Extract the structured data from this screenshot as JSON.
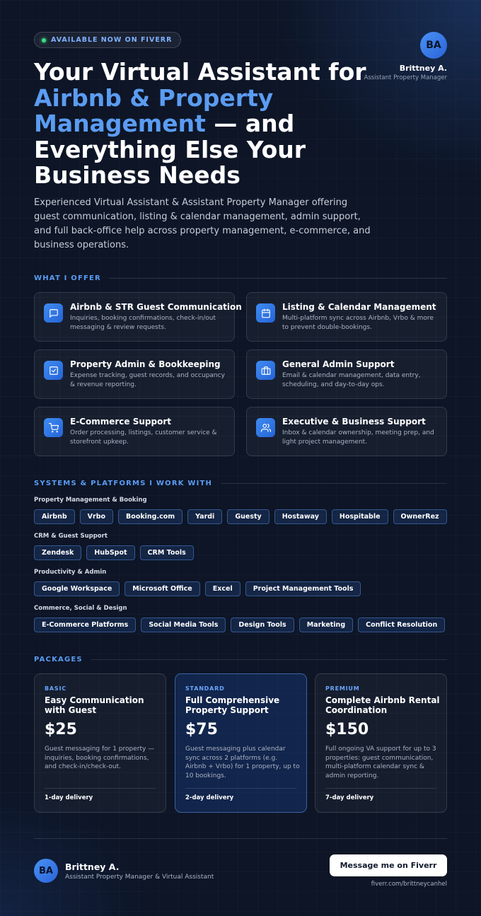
{
  "header": {
    "badge": "AVAILABLE NOW ON FIVERR",
    "avatar_initials": "BA",
    "name": "Brittney A.",
    "role": "Assistant Property Manager"
  },
  "hero": {
    "line1": "Your Virtual Assistant for",
    "accent": "Airbnb & Property Management",
    "line2": " — and Everything Else Your Business Needs",
    "intro": "Experienced Virtual Assistant & Assistant Property Manager offering guest communication, listing & calendar management, admin support, and full back-office help across property management, e-commerce, and business operations."
  },
  "offers": {
    "heading": "WHAT I OFFER",
    "items": [
      {
        "icon": "chat-icon",
        "title": "Airbnb & STR Guest Communication",
        "desc": "Inquiries, booking confirmations, check-in/out messaging & review requests."
      },
      {
        "icon": "calendar-icon",
        "title": "Listing & Calendar Management",
        "desc": "Multi-platform sync across Airbnb, Vrbo & more to prevent double-bookings."
      },
      {
        "icon": "checklist-icon",
        "title": "Property Admin & Bookkeeping",
        "desc": "Expense tracking, guest records, and occupancy & revenue reporting."
      },
      {
        "icon": "briefcase-icon",
        "title": "General Admin Support",
        "desc": "Email & calendar management, data entry, scheduling, and day-to-day ops."
      },
      {
        "icon": "cart-icon",
        "title": "E-Commerce Support",
        "desc": "Order processing, listings, customer service & storefront upkeep."
      },
      {
        "icon": "users-icon",
        "title": "Executive & Business Support",
        "desc": "Inbox & calendar ownership, meeting prep, and light project management."
      }
    ]
  },
  "platforms": {
    "heading": "SYSTEMS & PLATFORMS I WORK WITH",
    "groups": [
      {
        "label": "Property Management & Booking",
        "chips": [
          "Airbnb",
          "Vrbo",
          "Booking.com",
          "Yardi",
          "Guesty",
          "Hostaway",
          "Hospitable",
          "OwnerRez"
        ]
      },
      {
        "label": "CRM & Guest Support",
        "chips": [
          "Zendesk",
          "HubSpot",
          "CRM Tools"
        ]
      },
      {
        "label": "Productivity & Admin",
        "chips": [
          "Google Workspace",
          "Microsoft Office",
          "Excel",
          "Project Management Tools"
        ]
      },
      {
        "label": "Commerce, Social & Design",
        "chips": [
          "E-Commerce Platforms",
          "Social Media Tools",
          "Design Tools",
          "Marketing",
          "Conflict Resolution"
        ]
      }
    ]
  },
  "packages": {
    "heading": "PACKAGES",
    "items": [
      {
        "tier": "BASIC",
        "name": "Easy Communication with Guest",
        "price": "$25",
        "desc": "Guest messaging for 1 property — inquiries, booking confirmations, and check-in/check-out.",
        "delivery": "1-day delivery"
      },
      {
        "tier": "STANDARD",
        "name": "Full Comprehensive Property Support",
        "price": "$75",
        "desc": "Guest messaging plus calendar sync across 2 platforms (e.g. Airbnb + Vrbo) for 1 property, up to 10 bookings.",
        "delivery": "2-day delivery"
      },
      {
        "tier": "PREMIUM",
        "name": "Complete Airbnb Rental Coordination",
        "price": "$150",
        "desc": "Full ongoing VA support for up to 3 properties: guest communication, multi-platform calendar sync & admin reporting.",
        "delivery": "7-day delivery"
      }
    ]
  },
  "footer": {
    "avatar_initials": "BA",
    "name": "Brittney A.",
    "role": "Assistant Property Manager & Virtual Assistant",
    "cta": "Message me on Fiverr",
    "url": "fiverr.com/brittneycanhel"
  },
  "colors": {
    "accent": "#5b9cf2",
    "background": "#0d1526",
    "status_dot": "#3ddc84"
  }
}
